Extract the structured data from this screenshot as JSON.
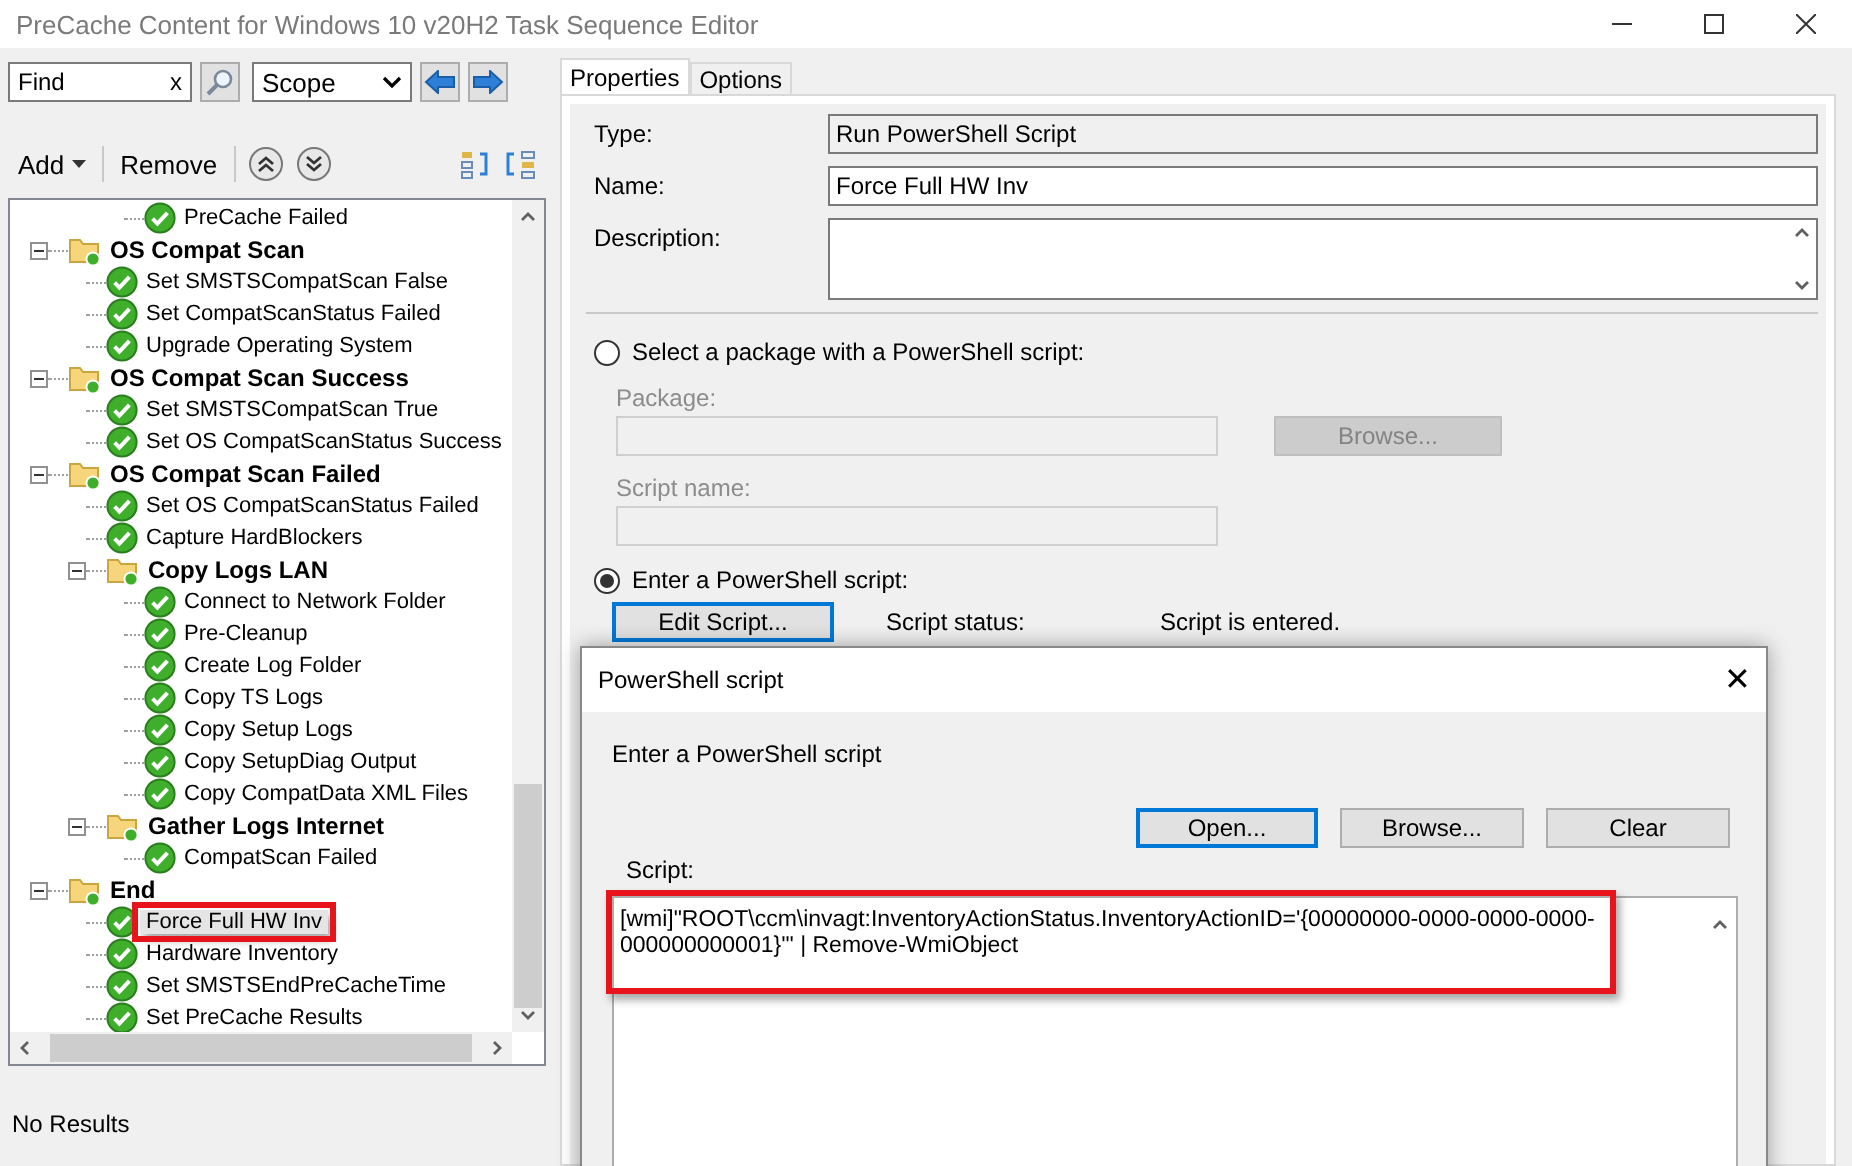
{
  "window": {
    "title": "PreCache Content for Windows 10 v20H2 Task Sequence Editor"
  },
  "search": {
    "value": "Find",
    "clear": "x"
  },
  "scope": {
    "value": "Scope"
  },
  "toolbar": {
    "add": "Add",
    "remove": "Remove"
  },
  "tree": {
    "partial_top": [
      {
        "label": "PreCache Failed",
        "selected": false
      }
    ],
    "items": [
      {
        "label": "OS Compat Scan",
        "kind": "group",
        "expanded": true,
        "selected": false,
        "children": [
          {
            "label": "Set SMSTSCompatScan False",
            "kind": "step",
            "selected": false
          },
          {
            "label": "Set CompatScanStatus Failed",
            "kind": "step",
            "selected": false
          },
          {
            "label": "Upgrade Operating System",
            "kind": "step",
            "selected": false
          }
        ]
      },
      {
        "label": "OS Compat Scan Success",
        "kind": "group",
        "expanded": true,
        "selected": false,
        "children": [
          {
            "label": "Set SMSTSCompatScan True",
            "kind": "step",
            "selected": false
          },
          {
            "label": "Set OS CompatScanStatus Success",
            "kind": "step",
            "selected": false
          }
        ]
      },
      {
        "label": "OS Compat Scan Failed",
        "kind": "group",
        "expanded": true,
        "selected": false,
        "children": [
          {
            "label": "Set OS CompatScanStatus Failed",
            "kind": "step",
            "selected": false
          },
          {
            "label": "Capture HardBlockers",
            "kind": "step",
            "selected": false
          },
          {
            "label": "Copy Logs LAN",
            "kind": "group",
            "expanded": true,
            "selected": false,
            "children": [
              {
                "label": "Connect to Network Folder",
                "kind": "step",
                "selected": false
              },
              {
                "label": "Pre-Cleanup",
                "kind": "step",
                "selected": false
              },
              {
                "label": "Create Log Folder",
                "kind": "step",
                "selected": false
              },
              {
                "label": "Copy TS Logs",
                "kind": "step",
                "selected": false
              },
              {
                "label": "Copy Setup Logs",
                "kind": "step",
                "selected": false
              },
              {
                "label": "Copy SetupDiag Output",
                "kind": "step",
                "selected": false
              },
              {
                "label": "Copy CompatData XML Files",
                "kind": "step",
                "selected": false
              }
            ]
          },
          {
            "label": "Gather Logs Internet",
            "kind": "group",
            "expanded": true,
            "selected": false,
            "children": [
              {
                "label": "CompatScan Failed",
                "kind": "step",
                "selected": false
              }
            ]
          }
        ]
      },
      {
        "label": "End",
        "kind": "group",
        "expanded": true,
        "selected": false,
        "children": [
          {
            "label": "Force Full HW Inv",
            "kind": "step",
            "selected": true
          },
          {
            "label": "Hardware Inventory",
            "kind": "step",
            "selected": false
          },
          {
            "label": "Set SMSTSEndPreCacheTime",
            "kind": "step",
            "selected": false
          },
          {
            "label": "Set PreCache Results",
            "kind": "step",
            "selected": false
          }
        ]
      }
    ]
  },
  "status_bar": "No Results",
  "tabs": [
    {
      "label": "Properties",
      "selected": true
    },
    {
      "label": "Options",
      "selected": false
    }
  ],
  "properties": {
    "type": {
      "label": "Type:",
      "value": "Run PowerShell Script"
    },
    "name": {
      "label": "Name:",
      "value": "Force Full HW Inv"
    },
    "description": {
      "label": "Description:"
    },
    "package_option": {
      "label": "Select a package with a PowerShell script:",
      "selected": false
    },
    "package": {
      "label": "Package:"
    },
    "browse": "Browse...",
    "script_name": {
      "label": "Script name:"
    },
    "script_option": {
      "label": "Enter a PowerShell script:",
      "selected": true
    },
    "edit_script": "Edit Script...",
    "script_status": {
      "label": "Script status:",
      "value": "Script is entered."
    }
  },
  "dialog": {
    "title": "PowerShell script",
    "close": "✕",
    "prompt": "Enter a PowerShell script",
    "buttons": [
      {
        "label": "Open...",
        "focused": true
      },
      {
        "label": "Browse...",
        "focused": false
      },
      {
        "label": "Clear",
        "focused": false
      }
    ],
    "script_label": "Script:",
    "script_lines": [
      "[wmi]\"ROOT\\ccm\\invagt:InventoryActionStatus.InventoryActionID='{00000000-0000-0000-0000-",
      "000000000001}'\" | Remove-WmiObject"
    ],
    "script_highlighted": true
  }
}
